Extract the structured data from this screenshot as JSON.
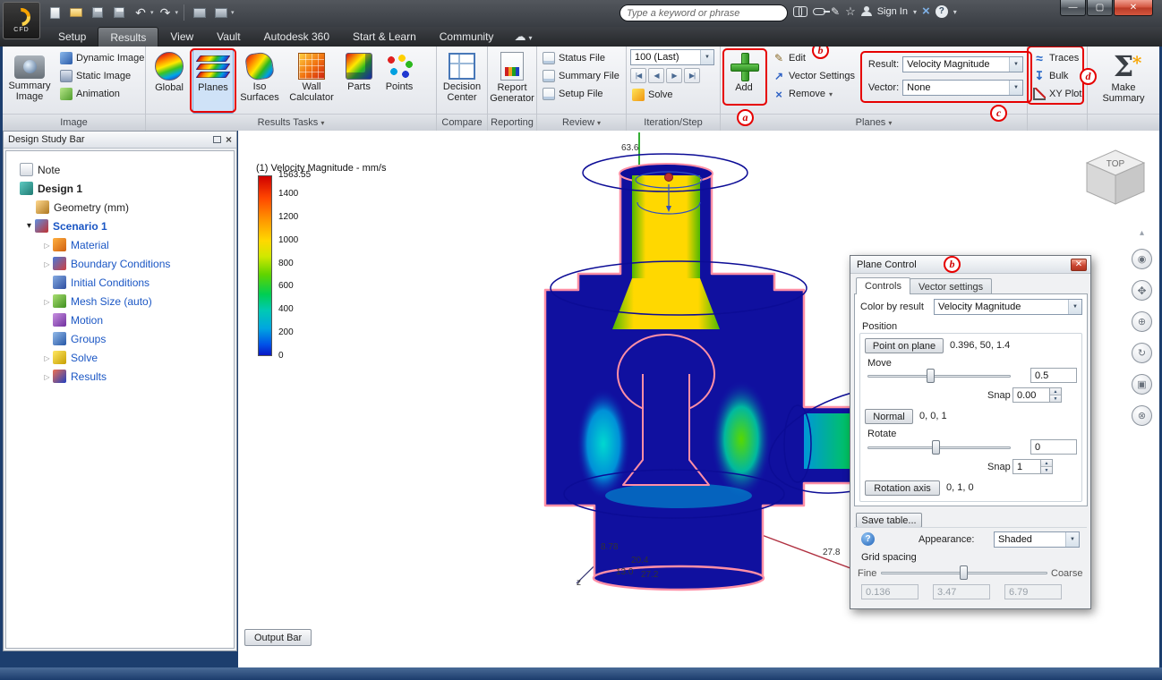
{
  "titlebar": {
    "app_badge": "CFD",
    "search_placeholder": "Type a keyword or phrase",
    "sign_in_label": "Sign In"
  },
  "menu_tabs": {
    "setup": "Setup",
    "results": "Results",
    "view": "View",
    "vault": "Vault",
    "autodesk360": "Autodesk 360",
    "start_learn": "Start & Learn",
    "community": "Community"
  },
  "ribbon": {
    "image": {
      "group_label": "Image",
      "summary_image": "Summary Image",
      "dynamic_image": "Dynamic Image",
      "static_image": "Static Image",
      "animation": "Animation"
    },
    "results_tasks": {
      "group_label": "Results Tasks",
      "global": "Global",
      "planes": "Planes",
      "iso_surfaces": "Iso Surfaces",
      "wall_calculator": "Wall Calculator",
      "parts": "Parts",
      "points": "Points"
    },
    "compare": {
      "group_label": "Compare",
      "decision_center": "Decision Center"
    },
    "reporting": {
      "group_label": "Reporting",
      "report_generator": "Report Generator"
    },
    "review": {
      "group_label": "Review",
      "status_file": "Status File",
      "summary_file": "Summary File",
      "setup_file": "Setup File"
    },
    "iteration": {
      "group_label": "Iteration/Step",
      "value": "100 (Last)",
      "solve": "Solve"
    },
    "planes_group": {
      "group_label": "Planes",
      "add": "Add",
      "edit": "Edit",
      "vector_settings": "Vector Settings",
      "remove": "Remove",
      "result_label": "Result:",
      "result_value": "Velocity Magnitude",
      "vector_label": "Vector:",
      "vector_value": "None"
    },
    "traces_group": {
      "traces": "Traces",
      "bulk": "Bulk",
      "xy_plot": "XY Plot"
    },
    "make_summary": "Make Summary"
  },
  "annotations": {
    "a": "a",
    "b": "b",
    "c": "c",
    "d": "d"
  },
  "design_study_bar": {
    "title": "Design Study Bar",
    "items": [
      {
        "label": "Note"
      },
      {
        "label": "Design 1"
      },
      {
        "label": "Geometry (mm)"
      },
      {
        "label": "Scenario 1"
      },
      {
        "label": "Material"
      },
      {
        "label": "Boundary Conditions"
      },
      {
        "label": "Initial Conditions"
      },
      {
        "label": "Mesh Size (auto)"
      },
      {
        "label": "Motion"
      },
      {
        "label": "Groups"
      },
      {
        "label": "Solve"
      },
      {
        "label": "Results"
      }
    ],
    "output_bar": "Output Bar"
  },
  "viewport": {
    "legend": {
      "title": "(1) Velocity Magnitude - mm/s",
      "max": "1563.55",
      "ticks": [
        "1400",
        "1200",
        "1000",
        "800",
        "600",
        "400",
        "200",
        "0"
      ]
    },
    "axis_labels": {
      "top": "63.6",
      "a1": "8.78",
      "a2": "20.4",
      "a3": "13.0",
      "a4": "27.2",
      "right": "27.8",
      "z": "z"
    },
    "viewcube_top": "TOP"
  },
  "plane_control": {
    "title": "Plane Control",
    "tab_controls": "Controls",
    "tab_vector": "Vector settings",
    "color_by_result_label": "Color by result",
    "color_by_result_value": "Velocity Magnitude",
    "position_label": "Position",
    "point_on_plane": "Point on plane",
    "point_value": "0.396, 50, 1.4",
    "move_label": "Move",
    "move_value": "0.5",
    "snap_label": "Snap",
    "move_snap": "0.00",
    "normal": "Normal",
    "normal_value": "0, 0, 1",
    "rotate_label": "Rotate",
    "rotate_value": "0",
    "rotate_snap": "1",
    "rotation_axis": "Rotation axis",
    "rotation_axis_value": "0, 1, 0",
    "save_table": "Save table...",
    "appearance_label": "Appearance:",
    "appearance_value": "Shaded",
    "grid_spacing_label": "Grid spacing",
    "fine": "Fine",
    "coarse": "Coarse",
    "grid_values": [
      "0.136",
      "3.47",
      "6.79"
    ]
  }
}
